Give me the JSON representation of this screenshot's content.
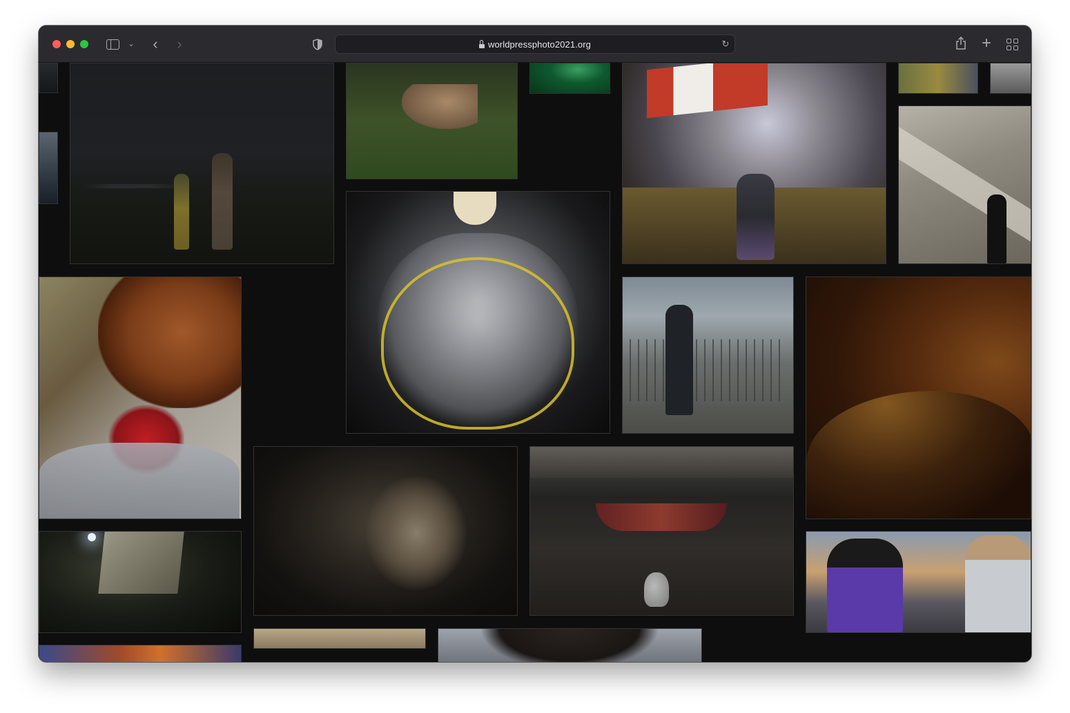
{
  "browser": {
    "url": "worldpressphoto2021.org",
    "icons": {
      "sidebar": "sidebar-icon",
      "chevron": "chevron-down-icon",
      "back": "back-icon",
      "forward": "forward-icon",
      "shield": "shield-icon",
      "lock": "lock-icon",
      "reload": "reload-icon",
      "share": "share-icon",
      "new_tab": "plus-icon",
      "tab_overview": "tab-grid-icon"
    }
  },
  "colors": {
    "toolbar": "#2b2a2f",
    "page_background": "#0e0e0e",
    "close": "#fe5f57",
    "minimize": "#febc2e",
    "zoom": "#28c840"
  },
  "gallery": {
    "photos": [
      {
        "id": "edge-left-top",
        "subject": "partial photo"
      },
      {
        "id": "edge-left-mid",
        "subject": "partial photo"
      },
      {
        "id": "couple-field",
        "subject": "couple dancing in field at dusk"
      },
      {
        "id": "cougar",
        "subject": "cougar in grass"
      },
      {
        "id": "green-light",
        "subject": "green lit scene"
      },
      {
        "id": "protest-flag",
        "subject": "protester with flag in tear gas"
      },
      {
        "id": "top-right-crowd",
        "subject": "partial photo"
      },
      {
        "id": "top-right-edge",
        "subject": "partial photo"
      },
      {
        "id": "escalator",
        "subject": "women on escalator"
      },
      {
        "id": "plastic-hug",
        "subject": "embrace through plastic curtain"
      },
      {
        "id": "fence-jump",
        "subject": "man climbing fence"
      },
      {
        "id": "wildfire-car",
        "subject": "wildfire seen from car"
      },
      {
        "id": "horse-hospital",
        "subject": "horse visiting patient"
      },
      {
        "id": "two-women",
        "subject": "two women embracing"
      },
      {
        "id": "hammock-hut",
        "subject": "hut with hammock and jar"
      },
      {
        "id": "night-box",
        "subject": "animals in box at night"
      },
      {
        "id": "statue-protest",
        "subject": "confrontation by statue"
      },
      {
        "id": "crowd-bottom",
        "subject": "partial photo"
      },
      {
        "id": "sky-bottom",
        "subject": "partial photo"
      },
      {
        "id": "bird-bottom",
        "subject": "partial photo"
      }
    ]
  }
}
